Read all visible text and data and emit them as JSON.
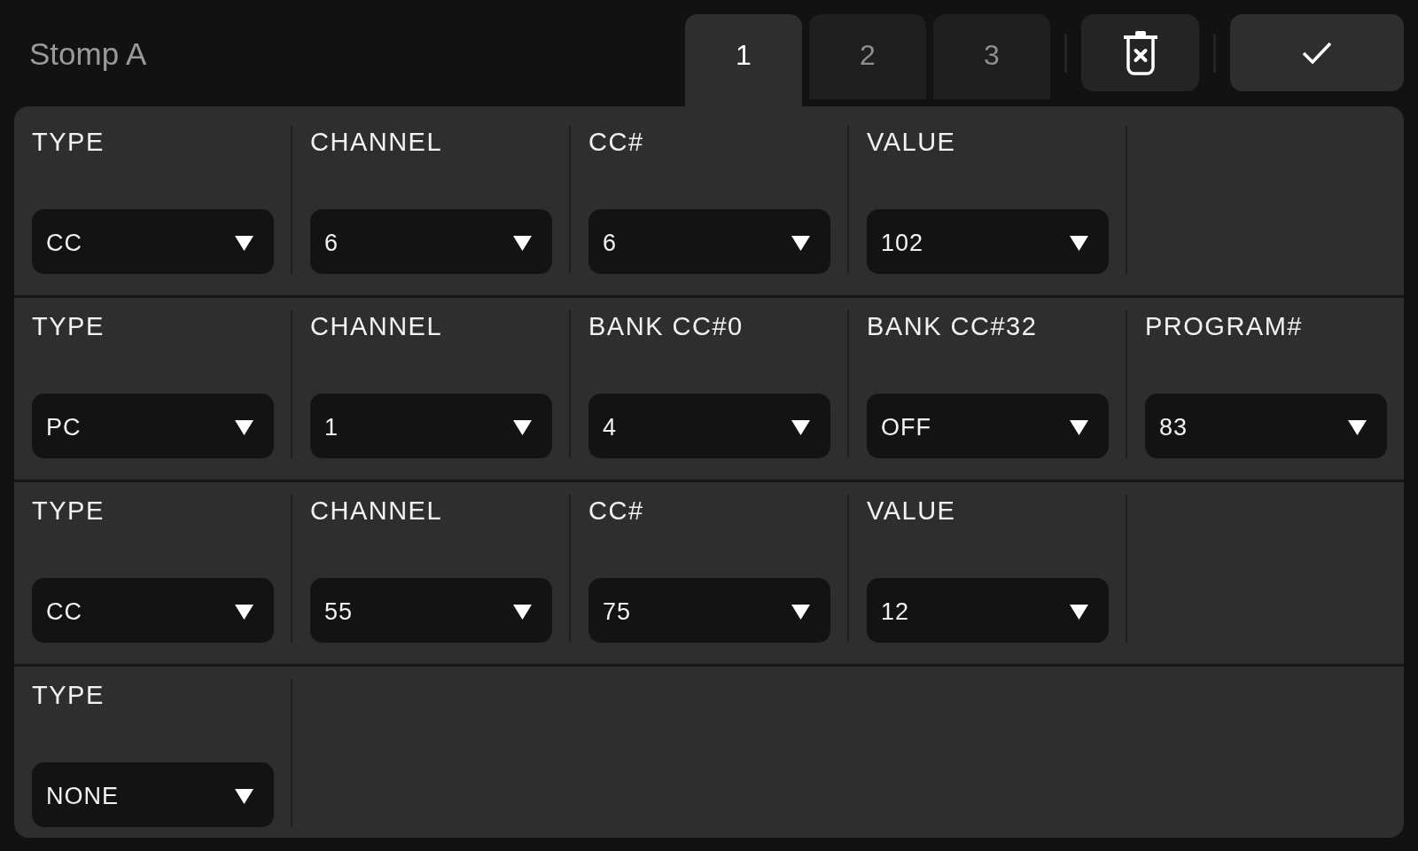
{
  "title": "Stomp A",
  "tabs": [
    {
      "label": "1",
      "selected": true
    },
    {
      "label": "2",
      "selected": false
    },
    {
      "label": "3",
      "selected": false
    }
  ],
  "rows": [
    {
      "fields": [
        {
          "label": "TYPE",
          "value": "CC"
        },
        {
          "label": "CHANNEL",
          "value": "6"
        },
        {
          "label": "CC#",
          "value": "6"
        },
        {
          "label": "VALUE",
          "value": "102"
        }
      ]
    },
    {
      "fields": [
        {
          "label": "TYPE",
          "value": "PC"
        },
        {
          "label": "CHANNEL",
          "value": "1"
        },
        {
          "label": "BANK CC#0",
          "value": "4"
        },
        {
          "label": "BANK CC#32",
          "value": "OFF"
        },
        {
          "label": "PROGRAM#",
          "value": "83"
        }
      ]
    },
    {
      "fields": [
        {
          "label": "TYPE",
          "value": "CC"
        },
        {
          "label": "CHANNEL",
          "value": "55"
        },
        {
          "label": "CC#",
          "value": "75"
        },
        {
          "label": "VALUE",
          "value": "12"
        }
      ]
    },
    {
      "fields": [
        {
          "label": "TYPE",
          "value": "NONE"
        }
      ]
    }
  ]
}
